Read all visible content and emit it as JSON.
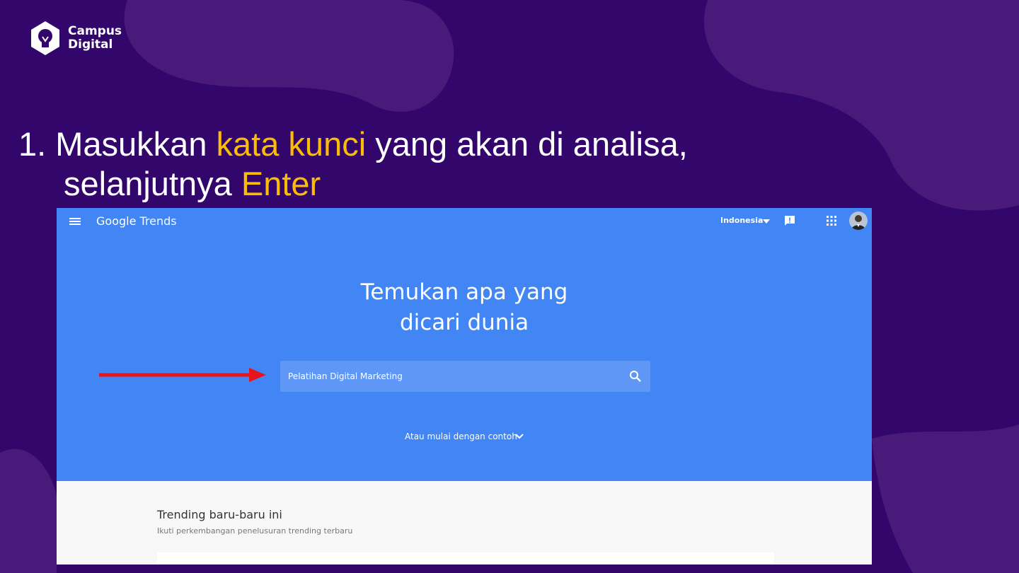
{
  "logo": {
    "line1": "Campus",
    "line2": "Digital",
    "icon": "lightbulb-hexagon-icon"
  },
  "heading": {
    "line1_prefix": "1. Masukkan ",
    "line1_highlight": "kata kunci",
    "line1_suffix": " yang akan di analisa,",
    "line2_prefix": "selanjutnya ",
    "line2_highlight": "Enter"
  },
  "colors": {
    "background": "#32066a",
    "highlight": "#fbbc05",
    "trends_blue": "#4285f4",
    "arrow": "#e8141b"
  },
  "trends": {
    "brand_google": "Google",
    "brand_trends": "Trends",
    "country": "Indonesia",
    "hero_line1": "Temukan apa yang",
    "hero_line2": "dicari dunia",
    "search_value": "Pelatihan Digital Marketing",
    "examples_label": "Atau mulai dengan contoh",
    "trending_title": "Trending baru-baru ini",
    "trending_subtitle": "Ikuti perkembangan penelusuran trending terbaru",
    "icons": [
      "menu-icon",
      "chevron-down-icon",
      "feedback-icon",
      "apps-icon",
      "avatar",
      "search-icon"
    ]
  }
}
